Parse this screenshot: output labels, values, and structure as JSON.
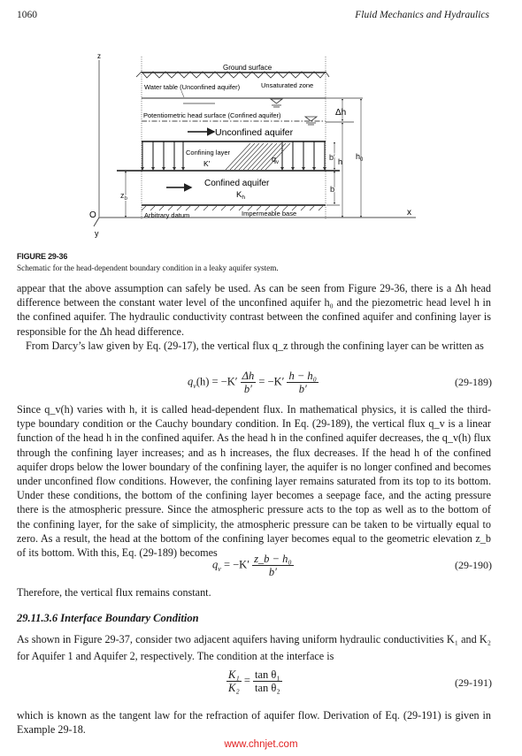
{
  "header": {
    "page_number": "1060",
    "running_title": "Fluid Mechanics and Hydraulics"
  },
  "figure": {
    "label": "FIGURE 29-36",
    "caption": "Schematic for the head-dependent boundary condition in a leaky aquifer system.",
    "labels": {
      "z_axis": "z",
      "x_axis": "x",
      "y_axis": "y",
      "origin": "O",
      "ground_surface": "Ground surface",
      "water_table": "Water table (Unconfined aquifer)",
      "unsaturated_zone": "Unsaturated  zone",
      "potentiometric": "Potentiometric head surface (Confined aquifer)",
      "unconfined_aquifer": "Unconfined aquifer",
      "confining_layer": "Confining layer",
      "confining_k": "K′",
      "qv": "q",
      "qv_sub": "v",
      "confined_aquifer": "Confined aquifer",
      "confined_k": "K",
      "confined_k_sub": "h",
      "arbitrary_datum": "Arbitrary datum",
      "impermeable_base": "Impermeable base",
      "delta_h": "Δh",
      "b_prime": "b′",
      "h": "h",
      "h0": "h",
      "h0_sub": "0",
      "b": "b",
      "zb": "z",
      "zb_sub": "b"
    }
  },
  "body": {
    "p1": "appear that the above assumption can safely be used. As can be seen from Figure 29-36, there is a Δh head difference between the constant water level of the unconfined aquifer h₀ and the piezometric head level h  in the confined aquifer. The hydraulic conductivity contrast between the confined aquifer and confining layer is responsible for the Δh head difference.",
    "p2": "From Darcy’s law given by Eq. (29-17), the vertical flux q_z through the confining layer can be written as",
    "p3": "Since q_v(h) varies with h, it is called head-dependent flux. In mathematical physics, it is called the third-type boundary condition or the Cauchy boundary condition. In Eq. (29-189), the vertical flux q_v is a linear function of the head h in the confined aquifer. As the head h in the confined aquifer decreases, the q_v(h) flux through the confining layer increases; and as h increases, the flux decreases. If the head h of the confined aquifer drops below the lower boundary of the confining layer, the aquifer is no longer confined and becomes under unconfined flow conditions. However, the confining layer remains saturated from its top to its bottom. Under these conditions, the bottom of the confining layer becomes a seepage face, and the acting pressure there is the atmospheric pressure. Since the atmospheric pressure acts to the top as well as to the bottom of the confining layer, for the sake of simplicity, the atmospheric pressure can be taken to be virtually equal to zero. As a result, the head at the bottom of the confining layer becomes equal to the geometric elevation z_b of its bottom. With this, Eq. (29-189) becomes",
    "p4": "Therefore, the vertical flux remains constant.",
    "section_heading": "29.11.3.6  Interface Boundary Condition",
    "p5": "As shown in Figure 29-37, consider two adjacent aquifers having uniform hydraulic conductivities K₁ and K₂ for Aquifer 1 and Aquifer 2, respectively. The condition at the interface is",
    "p6": "which is known as the tangent law for the refraction of aquifer flow. Derivation of Eq. (29-191) is given in Example 29-18."
  },
  "equations": {
    "eq189": {
      "lhs": "q",
      "lhs_sub": "v",
      "lhs_arg": "(h) = −K′",
      "frac1_num": "Δh",
      "frac1_den": "b′",
      "mid": " = −K′",
      "frac2_num": "h − h₀",
      "frac2_den": "b′",
      "number": "(29-189)"
    },
    "eq190": {
      "lhs": "q",
      "lhs_sub": "v",
      "mid": " = −K′",
      "frac_num": "z_b − h₀",
      "frac_den": "b′",
      "number": "(29-190)"
    },
    "eq191": {
      "frac1_num": "K₁",
      "frac1_den": "K₂",
      "eq": "=",
      "frac2_num": "tan θ₁",
      "frac2_den": "tan θ₂",
      "number": "(29-191)"
    }
  },
  "watermark": "www.chnjet.com"
}
